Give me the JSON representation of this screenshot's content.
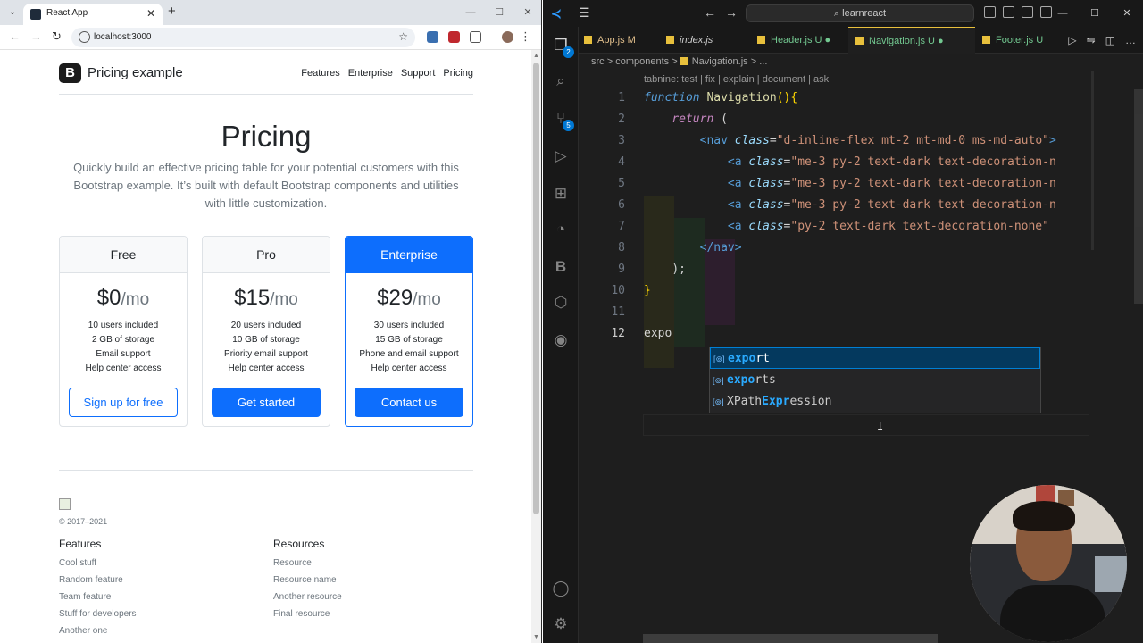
{
  "browser": {
    "tab_title": "React App",
    "url": "localhost:3000"
  },
  "site": {
    "brand_logo": "B",
    "brand_name": "Pricing example",
    "nav": [
      "Features",
      "Enterprise",
      "Support",
      "Pricing"
    ],
    "hero_title": "Pricing",
    "hero_lead": "Quickly build an effective pricing table for your potential customers with this Bootstrap example. It’s built with default Bootstrap components and utilities with little customization.",
    "plans": [
      {
        "name": "Free",
        "price": "$0",
        "per": "/mo",
        "features": [
          "10 users included",
          "2 GB of storage",
          "Email support",
          "Help center access"
        ],
        "button": "Sign up for free"
      },
      {
        "name": "Pro",
        "price": "$15",
        "per": "/mo",
        "features": [
          "20 users included",
          "10 GB of storage",
          "Priority email support",
          "Help center access"
        ],
        "button": "Get started"
      },
      {
        "name": "Enterprise",
        "price": "$29",
        "per": "/mo",
        "features": [
          "30 users included",
          "15 GB of storage",
          "Phone and email support",
          "Help center access"
        ],
        "button": "Contact us"
      }
    ],
    "footer": {
      "copyright": "© 2017–2021",
      "features_title": "Features",
      "features": [
        "Cool stuff",
        "Random feature",
        "Team feature",
        "Stuff for developers",
        "Another one"
      ],
      "resources_title": "Resources",
      "resources": [
        "Resource",
        "Resource name",
        "Another resource",
        "Final resource"
      ]
    }
  },
  "vscode": {
    "search": "learnreact",
    "explorer_badge": "2",
    "scm_badge": "5",
    "tabs": [
      {
        "name": "App.js",
        "status": "M"
      },
      {
        "name": "index.js",
        "status": ""
      },
      {
        "name": "Header.js",
        "status": "U ●"
      },
      {
        "name": "Navigation.js",
        "status": "U ●"
      },
      {
        "name": "Footer.js",
        "status": "U"
      }
    ],
    "breadcrumb": [
      "src",
      "components",
      "Navigation.js",
      "..."
    ],
    "codelens": "tabnine: test | fix | explain | document | ask",
    "line_numbers": [
      "1",
      "2",
      "3",
      "4",
      "5",
      "6",
      "7",
      "8",
      "9",
      "10",
      "11",
      "12"
    ],
    "typed_text": "expo",
    "suggestions": [
      {
        "icon": "[⊚]",
        "pre": "",
        "match": "expo",
        "post": "rt"
      },
      {
        "icon": "[⊚]",
        "pre": "",
        "match": "expo",
        "post": "rts"
      },
      {
        "icon": "[⊚]",
        "pre": "XPath",
        "match": "Expr",
        "post": "ession"
      }
    ],
    "code": {
      "l1_kw": "function",
      "l1_fn": "Navigation",
      "l1_p": "(){",
      "l2_kw": "return",
      "l2_p": " (",
      "l3_tag": "<nav",
      "l3_attr": "class",
      "l3_val": "\"d-inline-flex mt-2 mt-md-0 ms-md-auto\"",
      "l3_end": ">",
      "l4_tag": "<a",
      "l4_attr": "class",
      "l4_val": "\"me-3 py-2 text-dark text-decoration-n",
      "l5_val": "\"me-3 py-2 text-dark text-decoration-n",
      "l6_val": "\"me-3 py-2 text-dark text-decoration-n",
      "l7_val": "\"py-2 text-dark text-decoration-none\"",
      "l8_tag": "</nav>",
      "l9_p": ");",
      "l10_p": "}"
    }
  }
}
